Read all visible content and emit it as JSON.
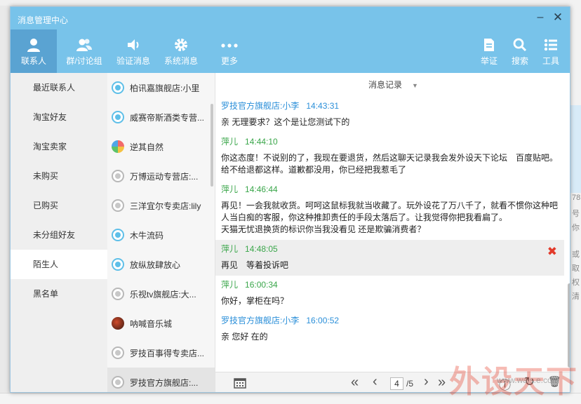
{
  "window": {
    "title": "消息管理中心",
    "minimize": "–",
    "close": "✕"
  },
  "toolbar": {
    "left": [
      {
        "label": "联系人",
        "icon": "person-icon"
      },
      {
        "label": "群/讨论组",
        "icon": "group-icon"
      },
      {
        "label": "验证消息",
        "icon": "speaker-icon"
      },
      {
        "label": "系统消息",
        "icon": "gear-icon"
      },
      {
        "label": "更多",
        "icon": "more-icon"
      }
    ],
    "right": [
      {
        "label": "举证",
        "icon": "document-icon"
      },
      {
        "label": "搜索",
        "icon": "search-icon"
      },
      {
        "label": "工具",
        "icon": "list-icon"
      }
    ]
  },
  "nav": {
    "items": [
      "最近联系人",
      "淘宝好友",
      "淘宝卖家",
      "未购买",
      "已购买",
      "未分组好友",
      "陌生人",
      "黑名单"
    ],
    "selected": "陌生人"
  },
  "contacts": [
    {
      "name": "柏讯嘉旗舰店:小里",
      "avatar": "blue"
    },
    {
      "name": "威赛帝斯酒类专营...",
      "avatar": "blue"
    },
    {
      "name": "逆其自然",
      "avatar": "multi"
    },
    {
      "name": "万博运动专营店:...",
      "avatar": "gray"
    },
    {
      "name": "三洋宜尔专卖店:lily",
      "avatar": "gray"
    },
    {
      "name": "木牛流码",
      "avatar": "blue"
    },
    {
      "name": "放纵放肆放心",
      "avatar": "blue"
    },
    {
      "name": "乐视tv旗舰店:大...",
      "avatar": "gray"
    },
    {
      "name": "呐喊音乐城",
      "avatar": "dark"
    },
    {
      "name": "罗技百事得专卖店...",
      "avatar": "gray"
    },
    {
      "name": "罗技官方旗舰店:...",
      "avatar": "gray"
    }
  ],
  "panel": {
    "header": "消息记录",
    "arrow": "▼",
    "messages": [
      {
        "sender": "罗技官方旗舰店:小李",
        "time": "14:43:31",
        "type": "shop",
        "lines": [
          "亲 无理要求？这个是让您测试下的"
        ]
      },
      {
        "sender": "萍儿",
        "time": "14:44:10",
        "type": "me",
        "lines": [
          "你这态度！不说别的了，我现在要退货，然后这聊天记录我会发外设天下论坛　百度贴吧。",
          "给不给退都这样。道歉都没用，你已经把我惹毛了"
        ]
      },
      {
        "sender": "萍儿",
        "time": "14:46:44",
        "type": "me",
        "lines": [
          "再见！一会我就收货。呵呵这鼠标我就当收藏了。玩外设花了万八千了，就看不惯你这种吧",
          "人当白痴的客服，你这种推卸责任的手段太落后了。让我觉得你把我看扁了。",
          "天猫无忧退换货的标识你当我没看见 还是欺骗消费者？"
        ]
      },
      {
        "sender": "萍儿",
        "time": "14:48:05",
        "type": "me",
        "highlight": true,
        "lines": [
          "再见　等着投诉吧"
        ]
      },
      {
        "sender": "萍儿",
        "time": "16:00:34",
        "type": "me",
        "lines": [
          "你好，掌柜在吗？"
        ]
      },
      {
        "sender": "罗技官方旗舰店:小李",
        "time": "16:00:52",
        "type": "shop",
        "lines": [
          "亲 您好 在的"
        ]
      }
    ],
    "delete_glyph": "✖"
  },
  "footer": {
    "calendar_icon": "calendar-icon",
    "first": "«",
    "prev": "‹",
    "page_current": "4",
    "page_total": "/5",
    "next": "›",
    "last": "»",
    "refresh": "↻",
    "trash": "🗑"
  },
  "background": {
    "side_lines": [
      "78",
      "号",
      "你",
      "或",
      "取",
      "权",
      "清"
    ]
  },
  "watermark": {
    "text": "外设天下",
    "sub": "www.wais.e.com"
  }
}
